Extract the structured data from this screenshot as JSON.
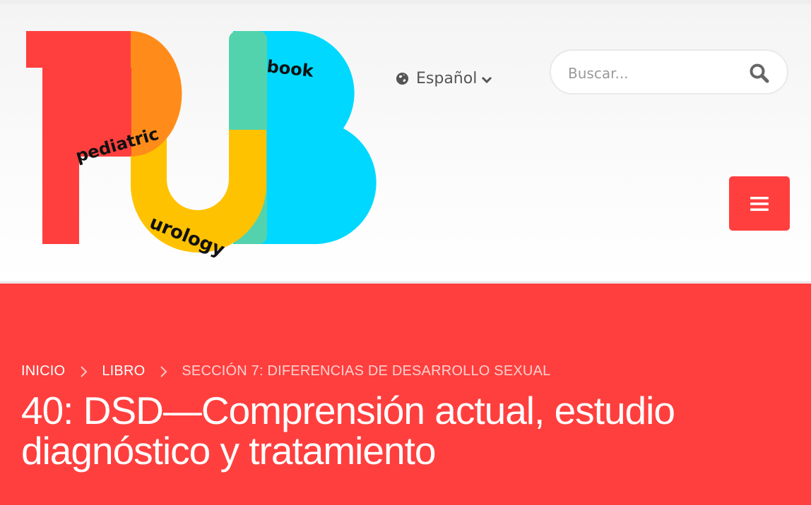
{
  "brand": {
    "logo_letters": "PUB",
    "logo_words": [
      "pediatric",
      "urology",
      "book"
    ],
    "colors": {
      "red": "#ff3f3e",
      "orange": "#ff8c1a",
      "yellow": "#ffc200",
      "green": "#53d3ad",
      "cyan": "#00d8ff"
    }
  },
  "header": {
    "language": {
      "label": "Español",
      "icon": "globe-icon",
      "caret_icon": "chevron-down-icon"
    },
    "search": {
      "placeholder": "Buscar...",
      "value": "",
      "icon": "search-icon"
    },
    "menu": {
      "icon": "hamburger-icon",
      "color": "#ff3f3e"
    }
  },
  "hero": {
    "background": "#ff3f3e",
    "breadcrumb": [
      {
        "label": "INICIO",
        "link": true
      },
      {
        "label": "LIBRO",
        "link": true
      },
      {
        "label": "SECCIÓN 7: DIFERENCIAS DE DESARROLLO SEXUAL",
        "link": false
      }
    ],
    "title": "40: DSD—Comprensión actual, estudio diagnóstico y tratamiento"
  }
}
